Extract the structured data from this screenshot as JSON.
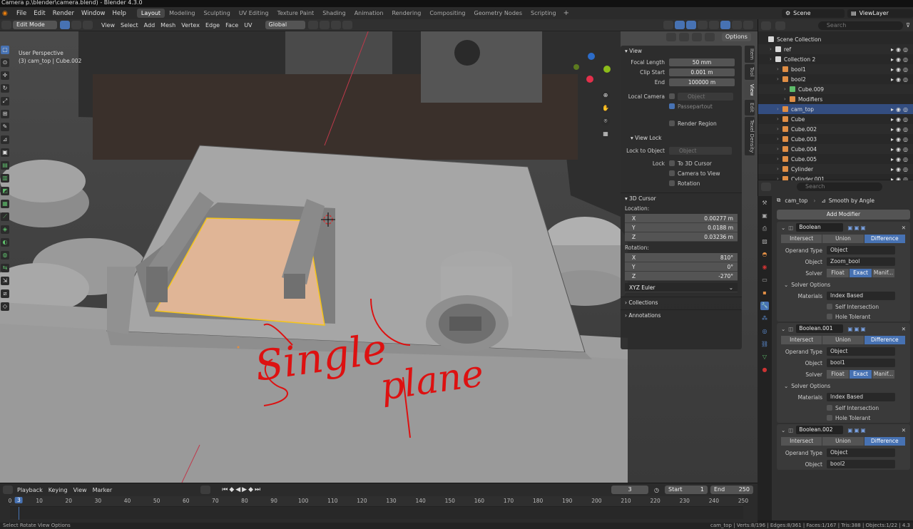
{
  "titlebar": "Camera p.\\blender\\camera.blend) - Blender 4.3.0",
  "menu": [
    "File",
    "Edit",
    "Render",
    "Window",
    "Help"
  ],
  "workspaces": [
    "Layout",
    "Modeling",
    "Sculpting",
    "UV Editing",
    "Texture Paint",
    "Shading",
    "Animation",
    "Rendering",
    "Compositing",
    "Geometry Nodes",
    "Scripting"
  ],
  "workspace_active": "Layout",
  "scene": "Scene",
  "view_layer": "ViewLayer",
  "header": {
    "mode": "Edit Mode",
    "menus": [
      "View",
      "Select",
      "Add",
      "Mesh",
      "Vertex",
      "Edge",
      "Face",
      "UV"
    ],
    "orientation": "Global",
    "options": "Options"
  },
  "viewport": {
    "perspective": "User Perspective",
    "object_info": "(3) cam_top | Cube.002",
    "annotation_line1": "Single",
    "annotation_line2": "plane"
  },
  "npanel": {
    "tabs": [
      "Item",
      "Tool",
      "View",
      "Edit",
      "Texel Density"
    ],
    "view_title": "View",
    "focal_length_label": "Focal Length",
    "focal_length": "50 mm",
    "clip_start_label": "Clip Start",
    "clip_start": "0.001 m",
    "clip_end_label": "End",
    "clip_end": "100000 m",
    "local_camera_label": "Local Camera",
    "local_camera_placeholder": "Object",
    "passepartout": "Passepartout",
    "render_region": "Render Region",
    "view_lock_title": "View Lock",
    "lock_to_object_label": "Lock to Object",
    "lock_to_object_placeholder": "Object",
    "lock_label": "Lock",
    "to_3d_cursor": "To 3D Cursor",
    "camera_to_view": "Camera to View",
    "rotation": "Rotation",
    "cursor_title": "3D Cursor",
    "location_label": "Location:",
    "loc": [
      {
        "axis": "X",
        "val": "0.00277 m"
      },
      {
        "axis": "Y",
        "val": "0.0188 m"
      },
      {
        "axis": "Z",
        "val": "0.03236 m"
      }
    ],
    "rotation_label": "Rotation:",
    "rot": [
      {
        "axis": "X",
        "val": "810°"
      },
      {
        "axis": "Y",
        "val": "0°"
      },
      {
        "axis": "Z",
        "val": "-270°"
      }
    ],
    "rot_mode": "XYZ Euler",
    "collections": "Collections",
    "annotations": "Annotations"
  },
  "outliner": {
    "search_placeholder": "Search",
    "rows": [
      {
        "label": "Scene Collection",
        "indent": 0
      },
      {
        "label": "ref",
        "indent": 1
      },
      {
        "label": "Collection 2",
        "indent": 1
      },
      {
        "label": "bool1",
        "indent": 2
      },
      {
        "label": "bool2",
        "indent": 2
      },
      {
        "label": "Cube.009",
        "indent": 3
      },
      {
        "label": "Modifiers",
        "indent": 3
      },
      {
        "label": "cam_top",
        "indent": 2
      },
      {
        "label": "Cube",
        "indent": 2
      },
      {
        "label": "Cube.002",
        "indent": 2
      },
      {
        "label": "Cube.003",
        "indent": 2
      },
      {
        "label": "Cube.004",
        "indent": 2
      },
      {
        "label": "Cube.005",
        "indent": 2
      },
      {
        "label": "Cylinder",
        "indent": 2
      },
      {
        "label": "Cylinder.001",
        "indent": 2
      }
    ]
  },
  "properties": {
    "search_placeholder": "Search",
    "object": "cam_top",
    "modifier_context": "Smooth by Angle",
    "add_modifier": "Add Modifier",
    "modifiers": [
      {
        "name": "Boolean",
        "object": "Zoom_bool"
      },
      {
        "name": "Boolean.001",
        "object": "bool1"
      },
      {
        "name": "Boolean.002",
        "object": "bool2"
      }
    ],
    "ops": [
      "Intersect",
      "Union",
      "Difference"
    ],
    "operand_type_label": "Operand Type",
    "operand_type": "Object",
    "object_label": "Object",
    "solver_label": "Solver",
    "solver": [
      "Float",
      "Exact",
      "Manif..."
    ],
    "solver_options": "Solver Options",
    "materials_label": "Materials",
    "materials": "Index Based",
    "self_intersection": "Self Intersection",
    "hole_tolerant": "Hole Tolerant"
  },
  "timeline": {
    "menus": [
      "Playback",
      "Keying",
      "View",
      "Marker"
    ],
    "current_frame": "3",
    "start_label": "Start",
    "start": "1",
    "end_label": "End",
    "end": "250",
    "ticks": [
      "0",
      "10",
      "20",
      "30",
      "40",
      "50",
      "60",
      "70",
      "80",
      "90",
      "100",
      "110",
      "120",
      "130",
      "140",
      "150",
      "160",
      "170",
      "180",
      "190",
      "200",
      "210",
      "220",
      "230",
      "240",
      "250"
    ]
  },
  "status": {
    "left": "Select   Rotate View   Options",
    "right": "cam_top | Verts:8/196 | Edges:8/361 | Faces:1/167 | Tris:388 | Objects:1/22 | 4.3"
  }
}
